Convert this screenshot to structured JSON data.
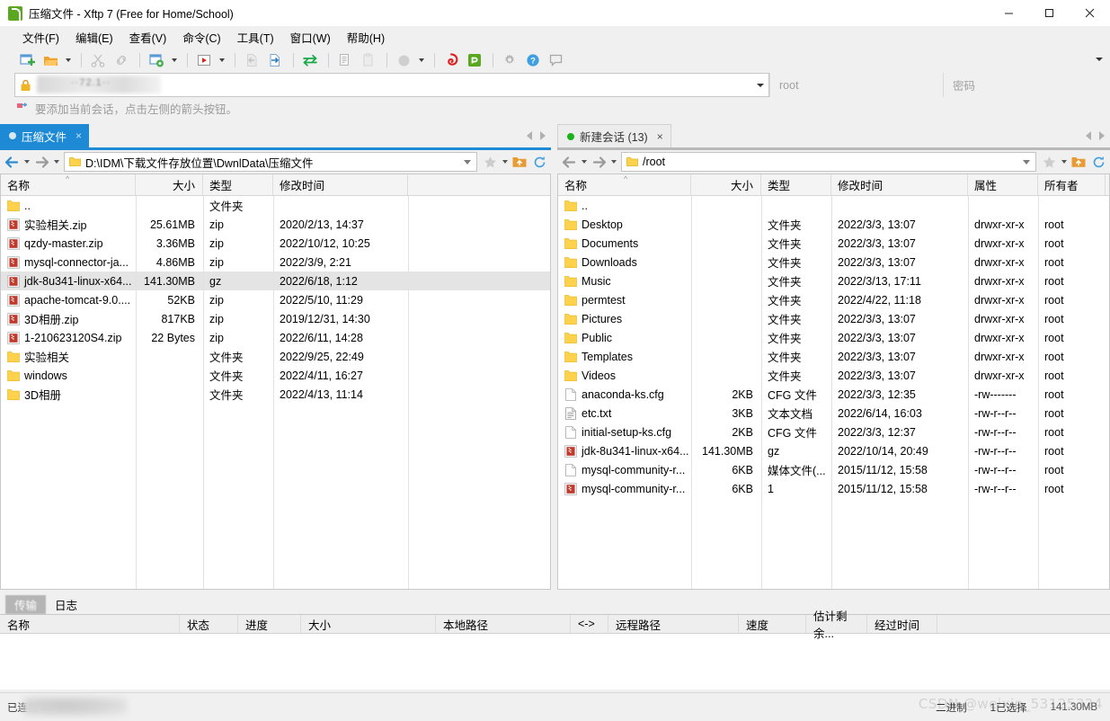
{
  "window": {
    "title": "压缩文件 - Xftp 7 (Free for Home/School)",
    "app_icon": "xftp-icon",
    "minimize": "—",
    "maximize": "□",
    "close": "✕"
  },
  "menubar": {
    "items": [
      {
        "label": "文件(F)",
        "name": "menu-file"
      },
      {
        "label": "编辑(E)",
        "name": "menu-edit"
      },
      {
        "label": "查看(V)",
        "name": "menu-view"
      },
      {
        "label": "命令(C)",
        "name": "menu-command"
      },
      {
        "label": "工具(T)",
        "name": "menu-tools"
      },
      {
        "label": "窗口(W)",
        "name": "menu-window"
      },
      {
        "label": "帮助(H)",
        "name": "menu-help"
      }
    ]
  },
  "toolbar": {
    "buttons": [
      "new-session-icon",
      "open-folder-icon",
      "cut-icon",
      "link-icon",
      "session-settings-icon",
      "run-icon",
      "transfer-left-icon",
      "transfer-right-icon",
      "sync-transfer-icon",
      "copy-icon",
      "paste-icon",
      "circle-icon",
      "xshell-icon",
      "xftp-icon-small",
      "gear-icon",
      "help-icon",
      "comment-icon"
    ],
    "overflow": "toolbar-overflow-chevron"
  },
  "session_bar": {
    "lock_icon": "lock-icon",
    "host_value": "··72.1··",
    "user_value": "root",
    "password_placeholder": "密码"
  },
  "hint": {
    "icon": "arrow-flag-icon",
    "text": "要添加当前会话，点击左侧的箭头按钮。"
  },
  "left_pane": {
    "tab": {
      "label": "压缩文件",
      "close": "×",
      "status_dot": "active"
    },
    "path": "D:\\IDM\\下载文件存放位置\\DwnlData\\压缩文件",
    "columns": [
      "名称",
      "大小",
      "类型",
      "修改时间"
    ],
    "rows": [
      {
        "icon": "folder-icon",
        "name": "..",
        "size": "",
        "type": "文件夹",
        "modified": "",
        "selected": false
      },
      {
        "icon": "archive-icon",
        "name": "实验相关.zip",
        "size": "25.61MB",
        "type": "zip",
        "modified": "2020/2/13, 14:37",
        "selected": false
      },
      {
        "icon": "archive-icon",
        "name": "qzdy-master.zip",
        "size": "3.36MB",
        "type": "zip",
        "modified": "2022/10/12, 10:25",
        "selected": false
      },
      {
        "icon": "archive-icon",
        "name": "mysql-connector-ja...",
        "size": "4.86MB",
        "type": "zip",
        "modified": "2022/3/9, 2:21",
        "selected": false
      },
      {
        "icon": "archive-icon",
        "name": "jdk-8u341-linux-x64...",
        "size": "141.30MB",
        "type": "gz",
        "modified": "2022/6/18, 1:12",
        "selected": true
      },
      {
        "icon": "archive-icon",
        "name": "apache-tomcat-9.0....",
        "size": "52KB",
        "type": "zip",
        "modified": "2022/5/10, 11:29",
        "selected": false
      },
      {
        "icon": "archive-icon",
        "name": "3D相册.zip",
        "size": "817KB",
        "type": "zip",
        "modified": "2019/12/31, 14:30",
        "selected": false
      },
      {
        "icon": "archive-icon",
        "name": "1-210623120S4.zip",
        "size": "22 Bytes",
        "type": "zip",
        "modified": "2022/6/11, 14:28",
        "selected": false
      },
      {
        "icon": "folder-icon",
        "name": "实验相关",
        "size": "",
        "type": "文件夹",
        "modified": "2022/9/25, 22:49",
        "selected": false
      },
      {
        "icon": "folder-icon",
        "name": "windows",
        "size": "",
        "type": "文件夹",
        "modified": "2022/4/11, 16:27",
        "selected": false
      },
      {
        "icon": "folder-icon",
        "name": "3D相册",
        "size": "",
        "type": "文件夹",
        "modified": "2022/4/13, 11:14",
        "selected": false
      }
    ]
  },
  "right_pane": {
    "tab": {
      "label": "新建会话 (13)",
      "close": "×",
      "status_dot": "connected"
    },
    "path": "/root",
    "columns": [
      "名称",
      "大小",
      "类型",
      "修改时间",
      "属性",
      "所有者"
    ],
    "rows": [
      {
        "icon": "folder-icon",
        "name": "..",
        "size": "",
        "type": "",
        "modified": "",
        "attrs": "",
        "owner": ""
      },
      {
        "icon": "folder-icon",
        "name": "Desktop",
        "size": "",
        "type": "文件夹",
        "modified": "2022/3/3, 13:07",
        "attrs": "drwxr-xr-x",
        "owner": "root"
      },
      {
        "icon": "folder-icon",
        "name": "Documents",
        "size": "",
        "type": "文件夹",
        "modified": "2022/3/3, 13:07",
        "attrs": "drwxr-xr-x",
        "owner": "root"
      },
      {
        "icon": "folder-icon",
        "name": "Downloads",
        "size": "",
        "type": "文件夹",
        "modified": "2022/3/3, 13:07",
        "attrs": "drwxr-xr-x",
        "owner": "root"
      },
      {
        "icon": "folder-icon",
        "name": "Music",
        "size": "",
        "type": "文件夹",
        "modified": "2022/3/13, 17:11",
        "attrs": "drwxr-xr-x",
        "owner": "root"
      },
      {
        "icon": "folder-icon",
        "name": "permtest",
        "size": "",
        "type": "文件夹",
        "modified": "2022/4/22, 11:18",
        "attrs": "drwxr-xr-x",
        "owner": "root"
      },
      {
        "icon": "folder-icon",
        "name": "Pictures",
        "size": "",
        "type": "文件夹",
        "modified": "2022/3/3, 13:07",
        "attrs": "drwxr-xr-x",
        "owner": "root"
      },
      {
        "icon": "folder-icon",
        "name": "Public",
        "size": "",
        "type": "文件夹",
        "modified": "2022/3/3, 13:07",
        "attrs": "drwxr-xr-x",
        "owner": "root"
      },
      {
        "icon": "folder-icon",
        "name": "Templates",
        "size": "",
        "type": "文件夹",
        "modified": "2022/3/3, 13:07",
        "attrs": "drwxr-xr-x",
        "owner": "root"
      },
      {
        "icon": "folder-icon",
        "name": "Videos",
        "size": "",
        "type": "文件夹",
        "modified": "2022/3/3, 13:07",
        "attrs": "drwxr-xr-x",
        "owner": "root"
      },
      {
        "icon": "file-icon",
        "name": "anaconda-ks.cfg",
        "size": "2KB",
        "type": "CFG 文件",
        "modified": "2022/3/3, 12:35",
        "attrs": "-rw-------",
        "owner": "root"
      },
      {
        "icon": "text-icon",
        "name": "etc.txt",
        "size": "3KB",
        "type": "文本文档",
        "modified": "2022/6/14, 16:03",
        "attrs": "-rw-r--r--",
        "owner": "root"
      },
      {
        "icon": "file-icon",
        "name": "initial-setup-ks.cfg",
        "size": "2KB",
        "type": "CFG 文件",
        "modified": "2022/3/3, 12:37",
        "attrs": "-rw-r--r--",
        "owner": "root"
      },
      {
        "icon": "archive-icon",
        "name": "jdk-8u341-linux-x64...",
        "size": "141.30MB",
        "type": "gz",
        "modified": "2022/10/14, 20:49",
        "attrs": "-rw-r--r--",
        "owner": "root"
      },
      {
        "icon": "file-icon",
        "name": "mysql-community-r...",
        "size": "6KB",
        "type": "媒体文件(...",
        "modified": "2015/11/12, 15:58",
        "attrs": "-rw-r--r--",
        "owner": "root"
      },
      {
        "icon": "archive-icon",
        "name": "mysql-community-r...",
        "size": "6KB",
        "type": "1",
        "modified": "2015/11/12, 15:58",
        "attrs": "-rw-r--r--",
        "owner": "root"
      }
    ]
  },
  "bottom_panel": {
    "tabs": [
      {
        "label": "传输",
        "name": "tab-transfer",
        "active": true
      },
      {
        "label": "日志",
        "name": "tab-log",
        "active": false
      }
    ],
    "columns": [
      "名称",
      "状态",
      "进度",
      "大小",
      "本地路径",
      "<->",
      "远程路径",
      "速度",
      "估计剩余...",
      "经过时间"
    ]
  },
  "status_bar": {
    "connection": "已连接",
    "mode": "二进制",
    "selection": "1已选择",
    "selected_size": "141.30MB",
    "watermark": "CSDN @weixin_53125324"
  },
  "colors": {
    "tab_active": "#1e8ad6",
    "selection_row": "#e4e4e4",
    "chrome": "#f0f0f0",
    "folder": "#ffd24d",
    "archive": "#c0392b"
  }
}
